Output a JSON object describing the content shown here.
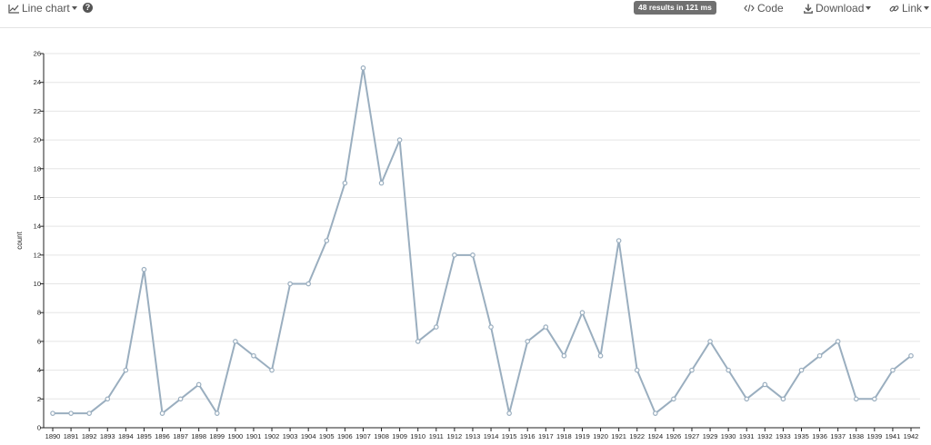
{
  "toolbar": {
    "chart_type_label": "Line chart",
    "results_badge": "48 results in 121 ms",
    "code_label": "Code",
    "download_label": "Download",
    "link_label": "Link"
  },
  "colors": {
    "line": "#9aaebf",
    "grid": "#e5e5e5",
    "axis": "#222222",
    "badge": "#707070"
  },
  "chart_data": {
    "type": "line",
    "ylabel": "count",
    "xlabel": "",
    "ylim": [
      0,
      26
    ],
    "yticks": [
      0,
      2,
      4,
      6,
      8,
      10,
      12,
      14,
      16,
      18,
      20,
      22,
      24,
      26
    ],
    "grid": "horizontal",
    "categories": [
      "1890",
      "1891",
      "1892",
      "1893",
      "1894",
      "1895",
      "1896",
      "1897",
      "1898",
      "1899",
      "1900",
      "1901",
      "1902",
      "1903",
      "1904",
      "1905",
      "1906",
      "1907",
      "1908",
      "1909",
      "1910",
      "1911",
      "1912",
      "1913",
      "1914",
      "1915",
      "1916",
      "1917",
      "1918",
      "1919",
      "1920",
      "1921",
      "1922",
      "1924",
      "1926",
      "1927",
      "1929",
      "1930",
      "1931",
      "1932",
      "1933",
      "1935",
      "1936",
      "1937",
      "1938",
      "1939",
      "1941",
      "1942"
    ],
    "series": [
      {
        "values": [
          1,
          1,
          1,
          2,
          4,
          11,
          1,
          2,
          3,
          1,
          6,
          5,
          4,
          10,
          10,
          13,
          17,
          25,
          17,
          20,
          6,
          7,
          12,
          12,
          7,
          1,
          6,
          7,
          5,
          8,
          5,
          13,
          4,
          1,
          2,
          4,
          6,
          4,
          2,
          3,
          2,
          4,
          5,
          6,
          2,
          2,
          4,
          5
        ]
      }
    ]
  }
}
